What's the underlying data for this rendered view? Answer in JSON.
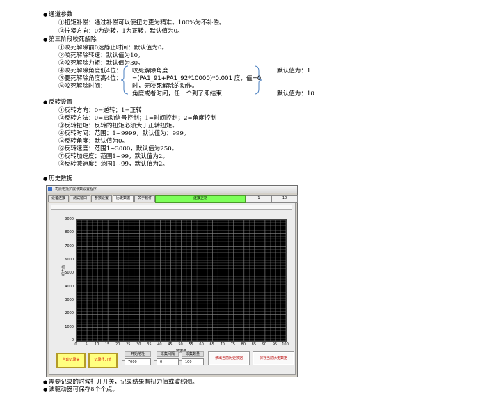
{
  "sections": {
    "channel": {
      "title": "通道参数",
      "lines": [
        "①扭矩补偿：通过补偿可以使扭力更为精准。100%为不补偿。",
        "②拧紧方向：0为逆转，1为正转，默认值为0。"
      ]
    },
    "stage3": {
      "title": "第三阶段咬死解除",
      "lines": [
        "①咬死解除前0速静止时间：默认值为0。",
        "②咬死解除转速：默认值为10。",
        "③咬死解除力矩：默认值为30。",
        "④咬死解除角度低4位：",
        "⑤要死解除角度高4位：",
        "⑥咬死解除时间："
      ],
      "note_lines": [
        "咬死解除角度",
        "=(PA1_91+PA1_92*10000)*0.001 度，值=0",
        "时，无咬死解除的动作。",
        "角度或者时间，任一个到了即结束"
      ],
      "default_1": "默认值为：1",
      "default_2": "默认值为：10"
    },
    "reverse": {
      "title": "反转设置",
      "lines": [
        "①反转方向：0=逆转；1=正转",
        "②反转方法：0=启动信号控制；1=时间控制；2=角度控制",
        "③反转扭矩：反转的扭矩必须大于正转扭矩。",
        "④反转时间：范围：1~9999，默认值为：999。",
        "⑤反转角度：默认值为0。",
        "⑥反转速度：范围1~3000，默认值为250。",
        "⑦反转加速度：范围1~99，默认值为2。",
        "⑧反转减速度：范围1~99，默认值为2。"
      ]
    },
    "history": {
      "title": "历史数据"
    },
    "footer": [
      "需要记录的时候打开开关，记录结果有扭力值或波线图。",
      "该驱动器可保存8个个点。"
    ]
  },
  "window": {
    "title": "司辰电批扩展参数设置程序",
    "tabs": [
      "设备连接",
      "测试窗口",
      "参数设置",
      "历史数据",
      "关于软件"
    ],
    "active_tab": "历史数据",
    "status": "连接正常",
    "box1": "1",
    "box2": "10",
    "buttons": {
      "auto_record": "自动记录关",
      "record_torque": "记录扭力值",
      "read_history": "读出当前历史数据",
      "save_history": "保存当前历史数据"
    },
    "fields": {
      "start_label": "开始地址",
      "start_value": "7000",
      "interval_label": "采集间隔",
      "interval_value": "0",
      "count_label": "采集数量",
      "count_value": "100"
    }
  },
  "chart_data": {
    "type": "line",
    "xlabel": "数据量",
    "ylabel": "扭力值",
    "xlim": [
      0,
      100
    ],
    "ylim": [
      0,
      9000
    ],
    "x_ticks": [
      "0",
      "5",
      "10",
      "15",
      "20",
      "25",
      "30",
      "35",
      "40",
      "45",
      "50",
      "55",
      "60",
      "65",
      "70",
      "75",
      "80",
      "85",
      "90",
      "95",
      "100"
    ],
    "y_ticks": [
      "0",
      "1000",
      "2000",
      "3000",
      "4000",
      "5000",
      "6000",
      "7000",
      "8000",
      "9000"
    ],
    "grid": true,
    "background": "#000000",
    "grid_color": "#8a8a8a",
    "series": []
  }
}
